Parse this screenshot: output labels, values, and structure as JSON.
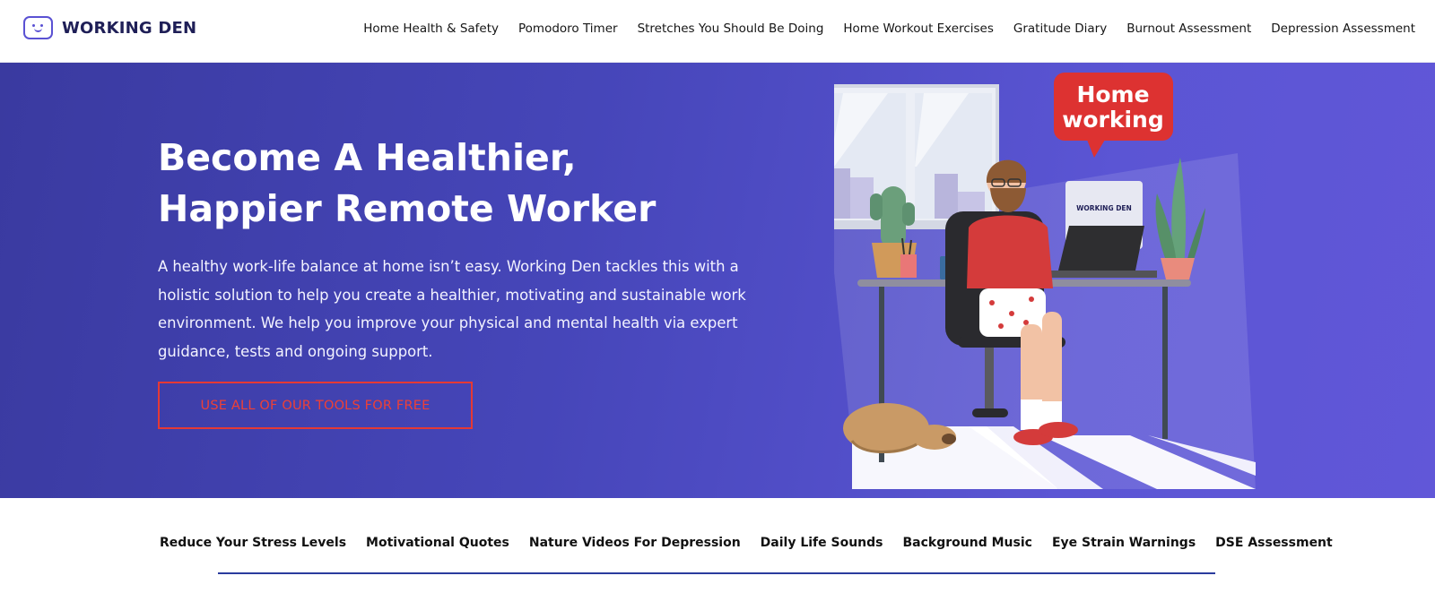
{
  "brand": {
    "name": "WORKING DEN"
  },
  "nav": {
    "items": [
      {
        "label": "Home Health & Safety"
      },
      {
        "label": "Pomodoro Timer"
      },
      {
        "label": "Stretches You Should Be Doing"
      },
      {
        "label": "Home Workout Exercises"
      },
      {
        "label": "Gratitude Diary"
      },
      {
        "label": "Burnout Assessment"
      },
      {
        "label": "Depression Assessment"
      }
    ]
  },
  "hero": {
    "title_line1": "Become A Healthier,",
    "title_line2": "Happier Remote Worker",
    "description": "A healthy work-life balance at home isn’t easy. Working Den tackles this with a holistic solution to help you create a healthier, motivating and sustainable work environment. We help you improve your physical and mental health via expert guidance, tests and ongoing support.",
    "cta_label": "USE ALL OF OUR TOOLS FOR FREE",
    "illustration": {
      "bubble_line1": "Home",
      "bubble_line2": "working",
      "monitor_brand": "WORKING DEN"
    }
  },
  "tools_tabs": {
    "items": [
      {
        "label": "Reduce Your Stress Levels"
      },
      {
        "label": "Motivational Quotes"
      },
      {
        "label": "Nature Videos For Depression"
      },
      {
        "label": "Daily Life Sounds"
      },
      {
        "label": "Background Music"
      },
      {
        "label": "Eye Strain Warnings"
      },
      {
        "label": "DSE Assessment"
      }
    ]
  },
  "colors": {
    "hero_bg": "#4646b9",
    "accent_red": "#e53935",
    "brand_purple": "#5a51d3",
    "tab_underline": "#2a3c9d"
  }
}
